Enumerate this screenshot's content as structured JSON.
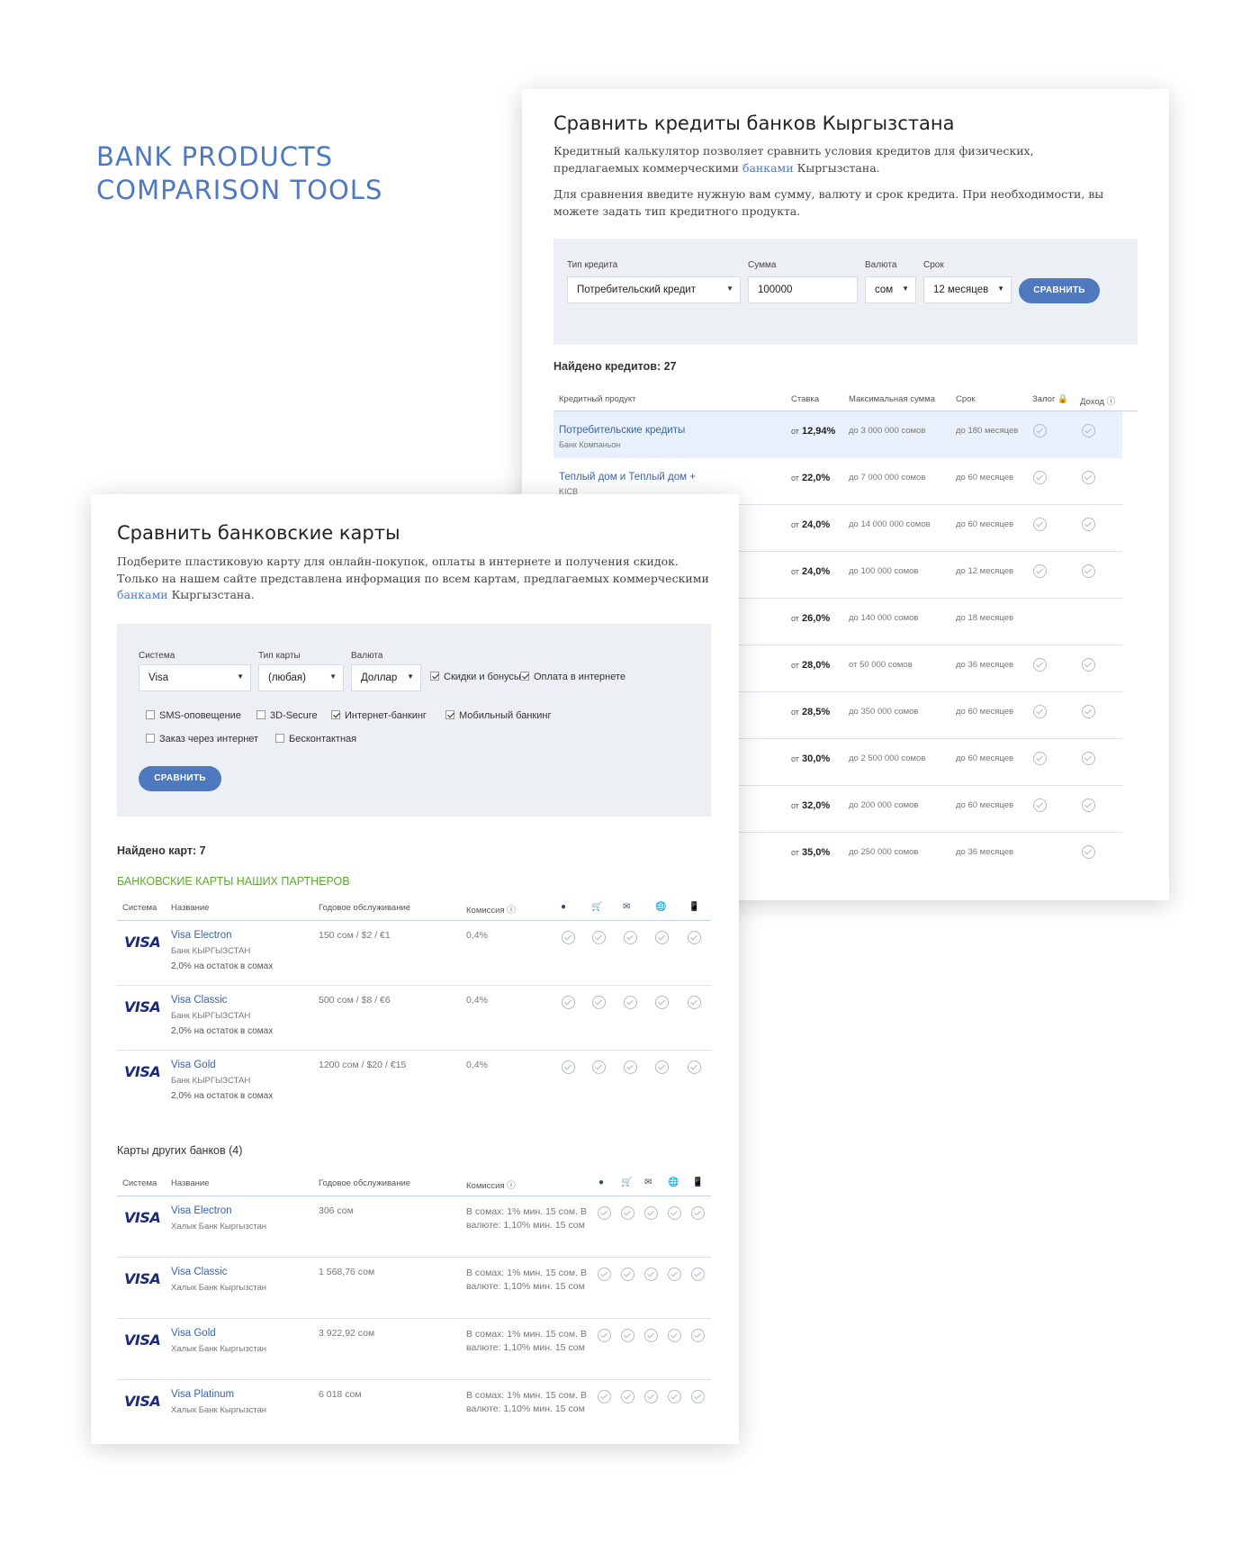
{
  "hero": {
    "line1": "BANK PRODUCTS",
    "line2": "COMPARISON TOOLS"
  },
  "credits": {
    "title": "Сравнить кредиты банков Кыргызстана",
    "desc1_pre": "Кредитный калькулятор позволяет сравнить условия кредитов для физических, предлагаемых коммерческими",
    "desc1_link": "банками",
    "desc1_post": "Кыргызстана.",
    "desc2": "Для сравнения введите нужную вам сумму, валюту и срок кредита. При необходимости, вы можете задать тип кредитного продукта.",
    "filter": {
      "type_label": "Тип кредита",
      "type_value": "Потребительский кредит",
      "sum_label": "Сумма",
      "sum_value": "100000",
      "currency_label": "Валюта",
      "currency_value": "сом",
      "term_label": "Срок",
      "term_value": "12 месяцев",
      "button": "СРАВНИТЬ"
    },
    "found": "Найдено кредитов: 27",
    "columns": {
      "product": "Кредитный продукт",
      "rate": "Ставка",
      "max": "Максимальная сумма",
      "term": "Срок",
      "pledge": "Залог",
      "income": "Доход"
    },
    "rows": [
      {
        "name": "Потребительские кредиты",
        "bank": "Банк Компаньон",
        "rate_prefix": "от",
        "rate": "12,94%",
        "max": "до 3 000 000 сомов",
        "term": "до 180 месяцев",
        "pledge": true,
        "income": true
      },
      {
        "name": "Теплый дом и Теплый дом +",
        "bank": "KICB",
        "rate_prefix": "от",
        "rate": "22,0%",
        "max": "до 7 000 000 сомов",
        "term": "до 60 месяцев",
        "pledge": true,
        "income": true
      },
      {
        "name": "",
        "bank": "",
        "rate_prefix": "от",
        "rate": "24,0%",
        "max": "до 14 000 000 сомов",
        "term": "до 60 месяцев",
        "pledge": true,
        "income": true
      },
      {
        "name": "",
        "bank": "",
        "rate_prefix": "от",
        "rate": "24,0%",
        "max": "до 100 000 сомов",
        "term": "до 12 месяцев",
        "pledge": true,
        "income": true
      },
      {
        "name": "",
        "bank": "",
        "rate_prefix": "от",
        "rate": "26,0%",
        "max": "до 140 000 сомов",
        "term": "до 18 месяцев",
        "pledge": false,
        "income": false
      },
      {
        "name": "",
        "bank": "",
        "rate_prefix": "от",
        "rate": "28,0%",
        "max": "от 50 000 сомов",
        "term": "до 36 месяцев",
        "pledge": true,
        "income": true
      },
      {
        "name": "",
        "bank": "",
        "rate_prefix": "от",
        "rate": "28,5%",
        "max": "до 350 000 сомов",
        "term": "до 60 месяцев",
        "pledge": true,
        "income": true
      },
      {
        "name": "",
        "bank": "",
        "rate_prefix": "от",
        "rate": "30,0%",
        "max": "до 2 500 000 сомов",
        "term": "до 60 месяцев",
        "pledge": true,
        "income": true
      },
      {
        "name": "",
        "bank": "",
        "rate_prefix": "от",
        "rate": "32,0%",
        "max": "до 200 000 сомов",
        "term": "до 60 месяцев",
        "pledge": true,
        "income": true
      },
      {
        "name": "",
        "bank": "",
        "rate_prefix": "от",
        "rate": "35,0%",
        "max": "до 250 000 сомов",
        "term": "до 36 месяцев",
        "pledge": false,
        "income": true
      }
    ]
  },
  "cards": {
    "title": "Сравнить банковские карты",
    "desc_line1": "Подберите пластиковую карту для онлайн-покупок, оплаты в интернете и получения скидок.",
    "desc_line2": "Только на нашем сайте представлена информация по всем картам, предлагаемых коммерческими",
    "desc_link": "банками",
    "desc_post": "Кыргызстана.",
    "filter": {
      "system_label": "Система",
      "system_value": "Visa",
      "type_label": "Тип карты",
      "type_value": "(любая)",
      "currency_label": "Валюта",
      "currency_value": "Доллар",
      "checkboxes": [
        {
          "label": "Скидки и бонусы",
          "checked": true
        },
        {
          "label": "Оплата в интернете",
          "checked": true
        },
        {
          "label": "SMS-оповещение",
          "checked": false
        },
        {
          "label": "3D-Secure",
          "checked": false
        },
        {
          "label": "Интернет-банкинг",
          "checked": true
        },
        {
          "label": "Мобильный банкинг",
          "checked": true
        },
        {
          "label": "Заказ через интернет",
          "checked": false
        },
        {
          "label": "Бесконтактная",
          "checked": false
        }
      ],
      "button": "СРАВНИТЬ"
    },
    "found": "Найдено карт: 7",
    "partners_title": "БАНКОВСКИЕ КАРТЫ НАШИХ ПАРТНЕРОВ",
    "others_title": "Карты других банков (4)",
    "columns": {
      "system": "Система",
      "name": "Название",
      "fee": "Годовое обслуживание",
      "commission": "Комиссия"
    },
    "feature_icons": [
      "circle-icon",
      "cart-icon",
      "envelope-icon",
      "globe-icon",
      "phone-icon"
    ],
    "partner_rows": [
      {
        "system": "VISA",
        "name": "Visa Electron",
        "bank": "Банк КЫРГЫЗСТАН",
        "promo": "2,0% на остаток в сомах",
        "fee": "150 сом / $2 / €1",
        "commission": "0,4%"
      },
      {
        "system": "VISA",
        "name": "Visa Classic",
        "bank": "Банк КЫРГЫЗСТАН",
        "promo": "2,0% на остаток в сомах",
        "fee": "500 сом / $8 / €6",
        "commission": "0,4%"
      },
      {
        "system": "VISA",
        "name": "Visa Gold",
        "bank": "Банк КЫРГЫЗСТАН",
        "promo": "2,0% на остаток в сомах",
        "fee": "1200 сом / $20 / €15",
        "commission": "0,4%"
      }
    ],
    "other_rows": [
      {
        "system": "VISA",
        "name": "Visa Electron",
        "bank": "Халык Банк Кыргызстан",
        "fee": "306 сом",
        "commission": "В сомах: 1% мин. 15 сом. В валюте: 1,10% мин. 15 сом"
      },
      {
        "system": "VISA",
        "name": "Visa Classic",
        "bank": "Халык Банк Кыргызстан",
        "fee": "1 568,76 сом",
        "commission": "В сомах: 1% мин. 15 сом. В валюте: 1,10% мин. 15 сом"
      },
      {
        "system": "VISA",
        "name": "Visa Gold",
        "bank": "Халык Банк Кыргызстан",
        "fee": "3 922,92 сом",
        "commission": "В сомах: 1% мин. 15 сом. В валюте: 1,10% мин. 15 сом"
      },
      {
        "system": "VISA",
        "name": "Visa Platinum",
        "bank": "Халык Банк Кыргызстан",
        "fee": "6 018 сом",
        "commission": "В сомах: 1% мин. 15 сом. В валюте: 1,10% мин. 15 сом"
      }
    ]
  }
}
